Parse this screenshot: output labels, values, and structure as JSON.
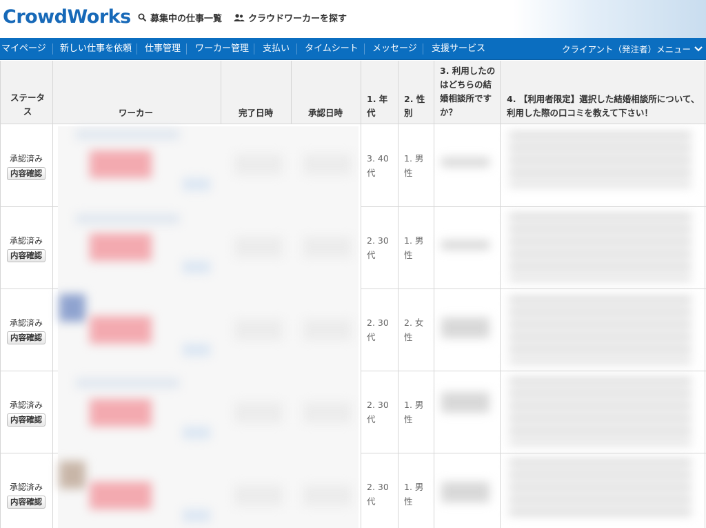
{
  "header": {
    "logo": "CrowdWorks",
    "links": [
      {
        "label": "募集中の仕事一覧",
        "icon": "search-icon"
      },
      {
        "label": "クラウドワーカーを探す",
        "icon": "people-icon"
      }
    ]
  },
  "nav": {
    "items": [
      "マイページ",
      "新しい仕事を依頼",
      "仕事管理",
      "ワーカー管理",
      "支払い",
      "タイムシート",
      "メッセージ",
      "支援サービス"
    ],
    "active": "仕事管理",
    "client_menu": "クライアント（発注者）メニュー",
    "colors": {
      "nav_bg": "#0b6ec0",
      "logo": "#1769b8"
    }
  },
  "table": {
    "headers": {
      "status": "ステータス",
      "worker": "ワーカー",
      "completed": "完了日時",
      "approved": "承認日時",
      "age": "1. 年代",
      "gender": "2. 性別",
      "q3": "3. 利用したのはどちらの結婚相談所ですか？",
      "q4": "4. 【利用者限定】選択した結婚相談所について、利用した際の口コミを教えて下さい！"
    },
    "rows": [
      {
        "status": "承認済み",
        "button": "内容確認",
        "age": "3. 40代",
        "gender": "1. 男性"
      },
      {
        "status": "承認済み",
        "button": "内容確認",
        "age": "2. 30代",
        "gender": "1. 男性"
      },
      {
        "status": "承認済み",
        "button": "内容確認",
        "age": "2. 30代",
        "gender": "2. 女性"
      },
      {
        "status": "承認済み",
        "button": "内容確認",
        "age": "2. 30代",
        "gender": "1. 男性"
      },
      {
        "status": "承認済み",
        "button": "内容確認",
        "age": "2. 30代",
        "gender": "1. 男性"
      }
    ]
  }
}
